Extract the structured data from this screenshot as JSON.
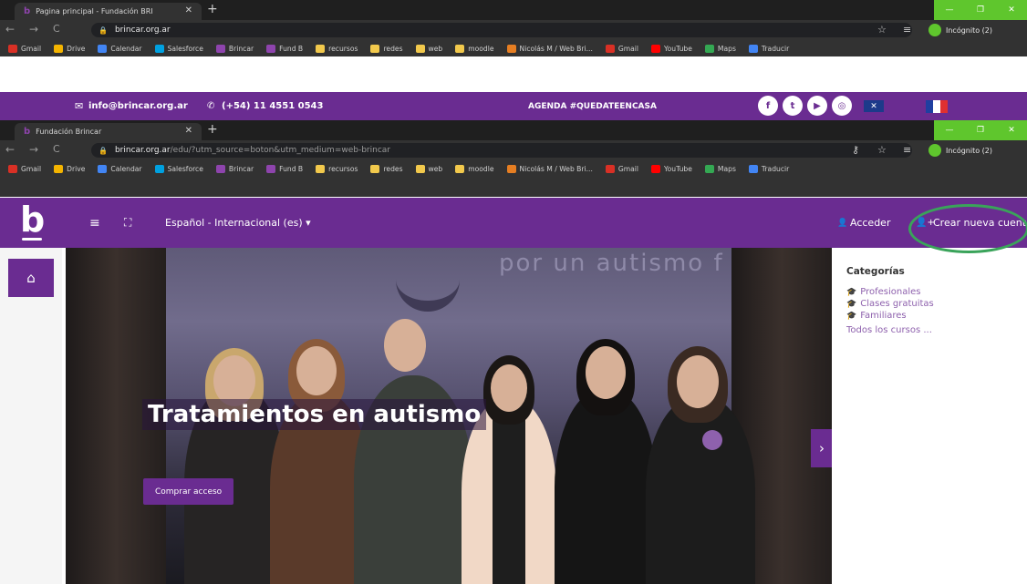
{
  "outer_browser": {
    "tab_title": "Pagina principal - Fundación BRI",
    "url": "brincar.org.ar",
    "profile": "Incógnito (2)"
  },
  "bookmarks": [
    {
      "label": "Gmail",
      "color": "#d93025"
    },
    {
      "label": "Drive",
      "color": "#f4b400"
    },
    {
      "label": "Calendar",
      "color": "#4285f4"
    },
    {
      "label": "Salesforce",
      "color": "#00a1e0"
    },
    {
      "label": "Brincar",
      "color": "#8e44ad"
    },
    {
      "label": "Fund B",
      "color": "#8e44ad"
    },
    {
      "label": "recursos",
      "color": "#f2c94c"
    },
    {
      "label": "redes",
      "color": "#f2c94c"
    },
    {
      "label": "web",
      "color": "#f2c94c"
    },
    {
      "label": "moodle",
      "color": "#f2c94c"
    },
    {
      "label": "Nicolás M / Web Bri...",
      "color": "#e67e22"
    },
    {
      "label": "Gmail",
      "color": "#d93025"
    },
    {
      "label": "YouTube",
      "color": "#ff0000"
    },
    {
      "label": "Maps",
      "color": "#34a853"
    },
    {
      "label": "Traducir",
      "color": "#4285f4"
    }
  ],
  "contact_bar": {
    "email": "info@brincar.org.ar",
    "phone": "(+54) 11 4551 0543",
    "agenda": "AGENDA #QUEDATEENCASA"
  },
  "inner_browser": {
    "tab_title": "Fundación Brincar",
    "url_host": "brincar.org.ar",
    "url_path": "/edu/?utm_source=boton&utm_medium=web-brincar",
    "profile": "Incógnito (2)"
  },
  "moodle_header": {
    "logo": "b",
    "language": "Español - Internacional (es)",
    "login": "Acceder",
    "signup": "Crear nueva cuenta"
  },
  "hero": {
    "title": "Tratamientos en autismo",
    "button": "Comprar acceso",
    "wall_text": "por un autismo f"
  },
  "categories": {
    "heading": "Categorías",
    "items": [
      "Profesionales",
      "Clases gratuitas",
      "Familiares"
    ],
    "all": "Todos los cursos ..."
  },
  "colors": {
    "brand_purple": "#6a2c91",
    "link": "#8e61ad",
    "highlight_ring": "#3aa35a"
  },
  "icons": [
    "envelope-icon",
    "phone-icon",
    "facebook-icon",
    "twitter-icon",
    "youtube-icon",
    "instagram-icon",
    "uk-flag-icon",
    "france-flag-icon",
    "hamburger-icon",
    "fullscreen-icon",
    "user-icon",
    "add-user-icon",
    "home-icon",
    "graduation-cap-icon",
    "chevron-right-icon"
  ]
}
